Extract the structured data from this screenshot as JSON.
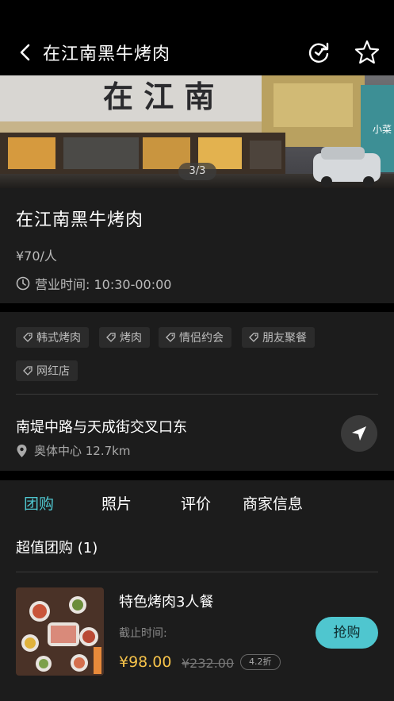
{
  "header": {
    "title": "在江南黑牛烤肉"
  },
  "hero": {
    "counter": "3/3"
  },
  "shop": {
    "name": "在江南黑牛烤肉",
    "price": "¥70/人",
    "hours": "营业时间: 10:30-00:00"
  },
  "tags": [
    "韩式烤肉",
    "烤肉",
    "情侣约会",
    "朋友聚餐",
    "网红店"
  ],
  "location": {
    "address": "南堤中路与天成街交叉口东",
    "distance": "奥体中心 12.7km"
  },
  "tabs": [
    "团购",
    "照片",
    "评价",
    "商家信息"
  ],
  "deals_section": {
    "title": "超值团购 (1)",
    "items": [
      {
        "name": "特色烤肉3人餐",
        "deadline": "截止时间:",
        "price": "¥98.00",
        "original_price": "¥232.00",
        "discount": "4.2折",
        "buy_label": "抢购"
      }
    ]
  },
  "colors": {
    "accent": "#4fc6cf",
    "price": "#f5c24a",
    "background": "#000000",
    "card": "#1c1c1c"
  }
}
